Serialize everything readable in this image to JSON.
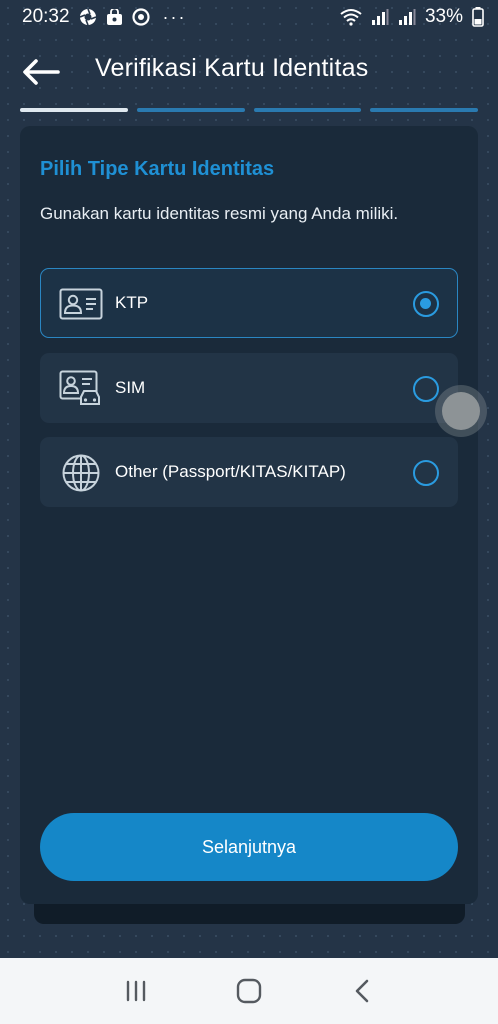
{
  "status_bar": {
    "time": "20:32",
    "battery": "33%",
    "more": "···"
  },
  "header": {
    "title": "Verifikasi Kartu Identitas"
  },
  "steps": {
    "total": 4,
    "current": 1
  },
  "card": {
    "title": "Pilih Tipe Kartu Identitas",
    "description": "Gunakan kartu identitas resmi yang Anda miliki.",
    "options": [
      {
        "label": "KTP",
        "icon": "id-card-icon",
        "selected": true
      },
      {
        "label": "SIM",
        "icon": "driver-license-icon",
        "selected": false
      },
      {
        "label": "Other (Passport/KITAS/KITAP)",
        "icon": "globe-icon",
        "selected": false
      }
    ],
    "next_label": "Selanjutnya"
  },
  "colors": {
    "background": "#243447",
    "card": "#1a2a3a",
    "accent": "#1587c8",
    "title_accent": "#1f90d4"
  }
}
